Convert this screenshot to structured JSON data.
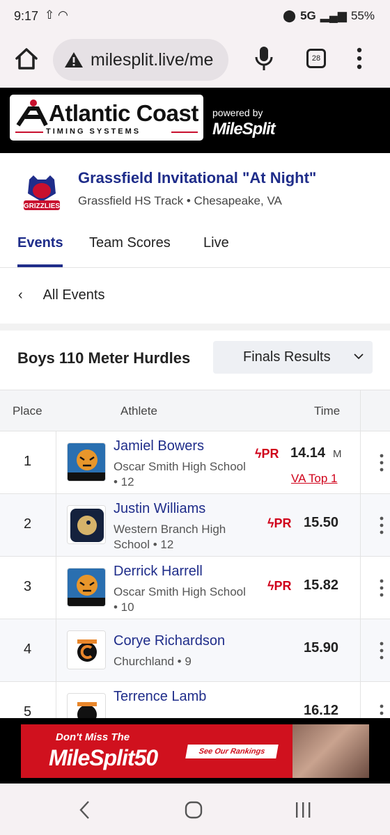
{
  "status": {
    "time": "9:17",
    "network": "5G",
    "battery": "55%"
  },
  "browser": {
    "url": "milesplit.live/me",
    "tab_count": "28"
  },
  "site": {
    "logo_line1": "Atlantic Coast",
    "logo_line2": "TIMING SYSTEMS",
    "powered_by": "powered by",
    "brand": "MileSplit"
  },
  "meet": {
    "logo_text": "GRIZZLIES",
    "title": "Grassfield Invitational \"At Night\"",
    "location": "Grassfield HS Track • Chesapeake, VA"
  },
  "tabs": [
    "Events",
    "Team Scores",
    "Live"
  ],
  "back_label": "All Events",
  "event": {
    "title": "Boys 110 Meter Hurdles",
    "round": "Finals Results"
  },
  "table": {
    "headers": {
      "place": "Place",
      "athlete": "Athlete",
      "time": "Time"
    },
    "rows": [
      {
        "place": "1",
        "name": "Jamiel Bowers",
        "school": "Oscar Smith High School • 12",
        "pr": "PR",
        "time": "14.14",
        "mark": "M",
        "rank": "VA Top 1"
      },
      {
        "place": "2",
        "name": "Justin Williams",
        "school": "Western Branch High School • 12",
        "pr": "PR",
        "time": "15.50"
      },
      {
        "place": "3",
        "name": "Derrick Harrell",
        "school": "Oscar Smith High School • 10",
        "pr": "PR",
        "time": "15.82"
      },
      {
        "place": "4",
        "name": "Corye Richardson",
        "school": "Churchland • 9",
        "time": "15.90"
      },
      {
        "place": "5",
        "name": "Terrence Lamb",
        "school": "",
        "time": "16.12"
      }
    ]
  },
  "ad": {
    "line1": "Don't Miss The",
    "line2": "MileSplit50",
    "cta": "See Our Rankings"
  },
  "colors": {
    "navy": "#1f2d8a",
    "red": "#d0021b"
  }
}
